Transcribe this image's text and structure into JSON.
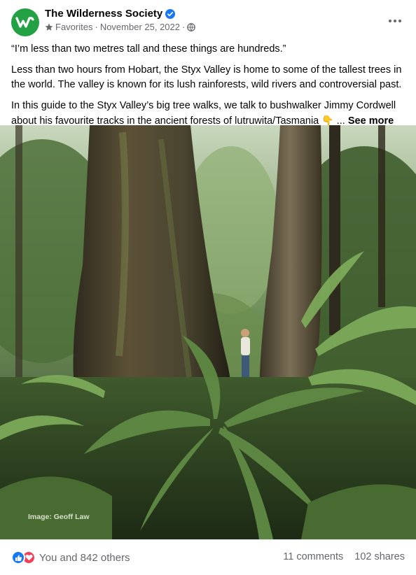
{
  "post": {
    "page_name": "The Wilderness Society",
    "audience_label": "Favorites",
    "separator": "·",
    "date": "November 25, 2022",
    "paragraphs": [
      "“I’m less than two metres tall and these things are hundreds.”",
      "Less than two hours from Hobart, the Styx Valley is home to some of the tallest trees in the world. The valley is known for its lush rainforests, wild rivers and controversial past.",
      "In this guide to the Styx Valley’s big tree walks, we talk to bushwalker Jimmy Cordwell about his favourite tracks in the ancient forests of lutruwita/Tasmania"
    ],
    "emoji": "👇",
    "ellipsis": "...",
    "see_more_label": "See more",
    "photo_credit": "Image: Geoff Law"
  },
  "engagement": {
    "reactions_text": "You and 842 others",
    "comments": "11 comments",
    "shares": "102 shares"
  },
  "colors": {
    "brand_green": "#24a045",
    "verified_blue": "#1877f2",
    "love_red": "#f33e58"
  },
  "icons": {
    "verified": "verified-badge-icon",
    "star": "star-icon",
    "globe": "globe-icon",
    "more": "more-dots-icon",
    "like": "like-icon",
    "love": "love-icon"
  }
}
